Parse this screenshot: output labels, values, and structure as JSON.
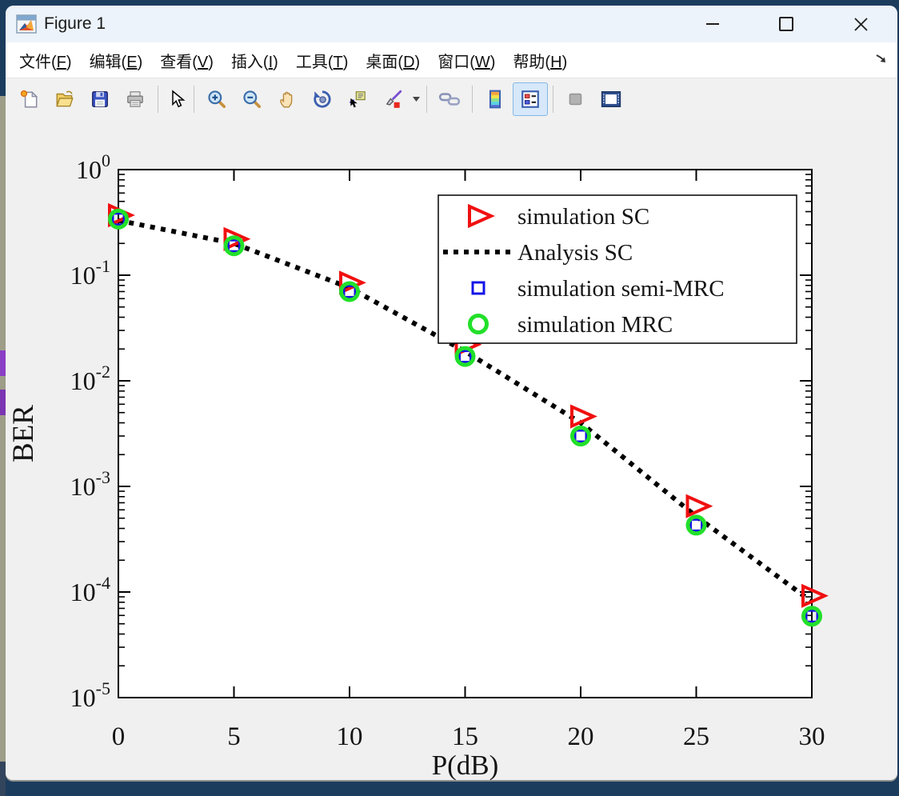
{
  "window": {
    "title": "Figure 1",
    "controls": {
      "minimize": "minimize",
      "maximize": "maximize",
      "close": "close"
    }
  },
  "menu": {
    "items": [
      {
        "pre": "文件(",
        "key": "F",
        "post": ")"
      },
      {
        "pre": "编辑(",
        "key": "E",
        "post": ")"
      },
      {
        "pre": "查看(",
        "key": "V",
        "post": ")"
      },
      {
        "pre": "插入(",
        "key": "I",
        "post": ")"
      },
      {
        "pre": "工具(",
        "key": "T",
        "post": ")"
      },
      {
        "pre": "桌面(",
        "key": "D",
        "post": ")"
      },
      {
        "pre": "窗口(",
        "key": "W",
        "post": ")"
      },
      {
        "pre": "帮助(",
        "key": "H",
        "post": ")"
      }
    ]
  },
  "toolbar": {
    "icons": [
      "new-file",
      "open-file",
      "save-figure",
      "print-figure",
      "edit-cursor",
      "zoom-in",
      "zoom-out",
      "pan",
      "rotate-3d",
      "data-cursor",
      "brush",
      "link-plot",
      "insert-colorbar",
      "insert-legend",
      "hide-plot-tools",
      "show-plot-tools-dock"
    ],
    "selected": "insert-legend"
  },
  "chart_data": {
    "type": "line",
    "title": "",
    "xlabel": "P(dB)",
    "ylabel": "BER",
    "x": [
      0,
      5,
      10,
      15,
      20,
      25,
      30
    ],
    "xlim": [
      0,
      30
    ],
    "x_ticks": [
      0,
      5,
      10,
      15,
      20,
      25,
      30
    ],
    "yscale": "log",
    "ylim": [
      1e-05,
      1
    ],
    "y_tick_exponents": [
      0,
      -1,
      -2,
      -3,
      -4,
      -5
    ],
    "grid": false,
    "legend_position": "upper right",
    "series": [
      {
        "name": "simulation SC",
        "marker": "triangle-right",
        "line": "none",
        "color": "#f01010",
        "values": [
          0.37,
          0.22,
          0.085,
          0.022,
          0.0046,
          0.00065,
          9.2e-05
        ]
      },
      {
        "name": "Analysis SC",
        "marker": "none",
        "line": "dotted",
        "color": "#000000",
        "values": [
          0.33,
          0.2,
          0.076,
          0.019,
          0.004,
          0.00052,
          8.1e-05
        ]
      },
      {
        "name": "simulation semi-MRC",
        "marker": "square",
        "line": "none",
        "color": "#1414e6",
        "values": [
          0.34,
          0.19,
          0.07,
          0.017,
          0.003,
          0.00043,
          5.9e-05
        ]
      },
      {
        "name": "simulation MRC",
        "marker": "circle",
        "line": "none",
        "color": "#22e02a",
        "values": [
          0.34,
          0.19,
          0.07,
          0.017,
          0.003,
          0.00043,
          5.9e-05
        ]
      }
    ]
  }
}
